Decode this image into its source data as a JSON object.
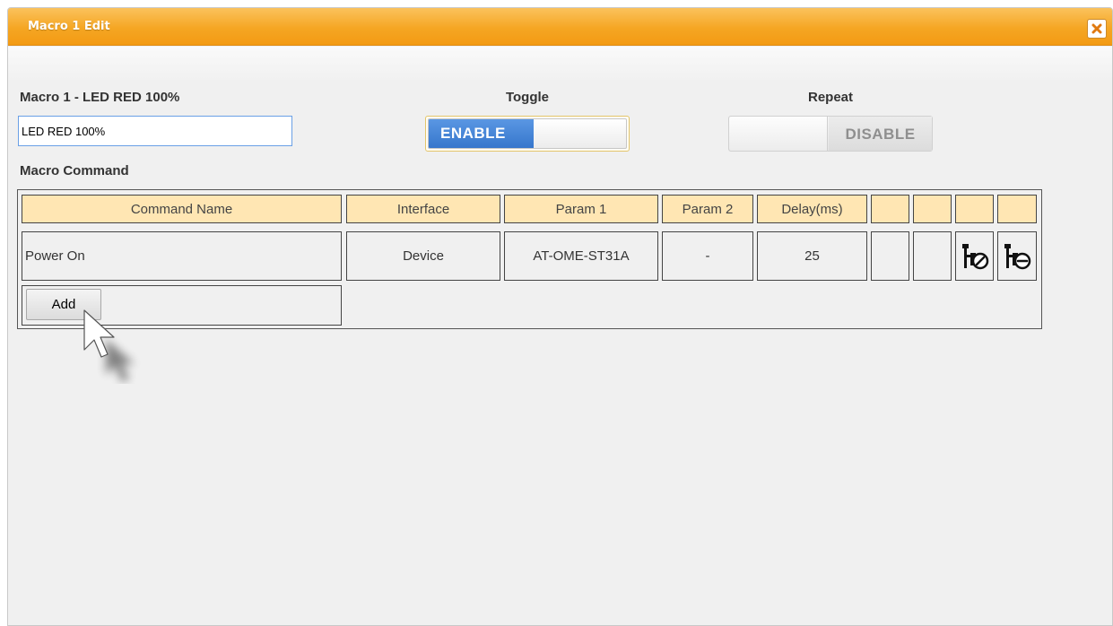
{
  "dialog": {
    "title": "Macro 1 Edit",
    "close_icon": "close-x-icon",
    "accent_color": "#f5a623"
  },
  "macro": {
    "heading": "Macro 1 - LED RED 100%",
    "name_value": "LED RED 100%"
  },
  "toggle": {
    "label": "Toggle",
    "state_text": "ENABLE",
    "enabled": true,
    "on_color": "#3676cc"
  },
  "repeat": {
    "label": "Repeat",
    "state_text": "DISABLE",
    "enabled": false
  },
  "commands": {
    "section_label": "Macro Command",
    "headers": [
      "Command Name",
      "Interface",
      "Param 1",
      "Param 2",
      "Delay(ms)",
      "",
      "",
      "",
      ""
    ],
    "header_color": "#ffe6b3",
    "rows": [
      {
        "command_name": "Power On",
        "interface": "Device",
        "param1": "AT-OME-ST31A",
        "param2": "-",
        "delay": "25",
        "edit_icon": "edit-command-icon",
        "delete_icon": "delete-command-icon"
      }
    ],
    "add_label": "Add"
  },
  "pointer_icon": "mouse-pointer-icon"
}
